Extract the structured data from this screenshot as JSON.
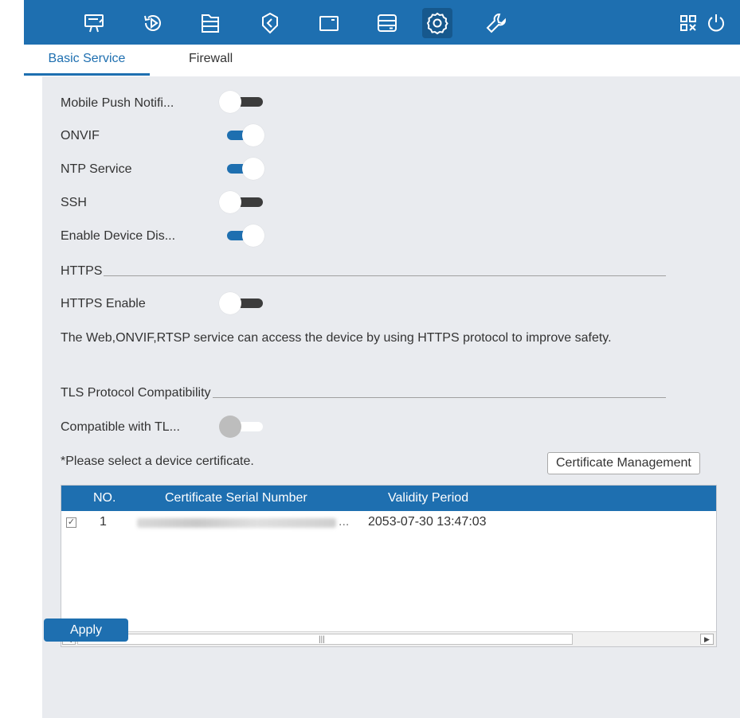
{
  "topbar": {
    "icons": [
      {
        "name": "live-view-icon"
      },
      {
        "name": "playback-icon"
      },
      {
        "name": "file-icon"
      },
      {
        "name": "smart-icon"
      },
      {
        "name": "channel-icon"
      },
      {
        "name": "storage-icon"
      },
      {
        "name": "settings-icon",
        "active": true
      },
      {
        "name": "maintenance-icon"
      }
    ],
    "right_icons": [
      "qr-code-icon",
      "power-icon"
    ],
    "accent": "#1e6fb0"
  },
  "tabs": [
    {
      "label": "Basic Service",
      "active": true
    },
    {
      "label": "Firewall",
      "active": false
    }
  ],
  "settings": {
    "mobile_push": {
      "label": "Mobile Push Notifi...",
      "state": "off"
    },
    "onvif": {
      "label": "ONVIF",
      "state": "on"
    },
    "ntp": {
      "label": "NTP Service",
      "state": "on"
    },
    "ssh": {
      "label": "SSH",
      "state": "off"
    },
    "device_discovery": {
      "label": "Enable Device Dis...",
      "state": "on"
    },
    "https_section": "HTTPS",
    "https_enable": {
      "label": "HTTPS Enable",
      "state": "off"
    },
    "https_desc": "The Web,ONVIF,RTSP service can access the device by using HTTPS protocol to improve safety.",
    "tls_section": "TLS Protocol Compatibility",
    "tls_compat": {
      "label": "Compatible with TL...",
      "state": "disabled"
    }
  },
  "certificate": {
    "prompt": "*Please select a device certificate.",
    "manage_button": "Certificate Management",
    "columns": {
      "no": "NO.",
      "serial": "Certificate Serial Number",
      "validity": "Validity Period"
    },
    "rows": [
      {
        "checked": true,
        "check_mark": "✓",
        "no": "1",
        "serial_suffix": "...",
        "validity": "2053-07-30 13:47:03"
      }
    ],
    "scroll_left": "◀",
    "scroll_right": "▶",
    "scroll_grip": "|||"
  },
  "apply_button": "Apply"
}
